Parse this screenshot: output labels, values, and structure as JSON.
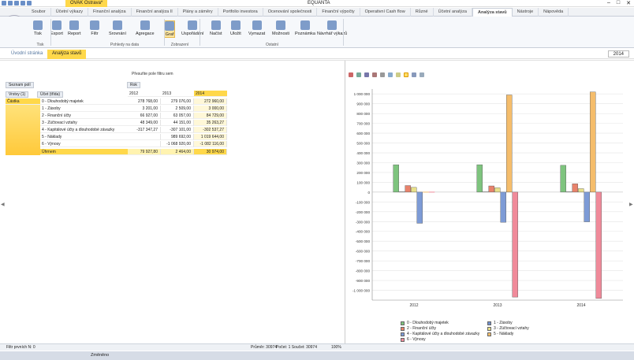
{
  "titlebar": {
    "doc": "OVAK Ostrava*",
    "app": "EQUANTA"
  },
  "menu": [
    "Soubor",
    "Účetní výkazy",
    "Finanční analýza",
    "Finanční analýza II",
    "Plány a záměry",
    "Portfolio investora",
    "Ocenování společnosti",
    "Finanční výpočty",
    "Operativní Cash flow",
    "Různé",
    "Účetní analýza",
    "Analýza stavů",
    "Nástroje",
    "Nápověda"
  ],
  "menu_active": 11,
  "ribbon": {
    "buttons": [
      "Tisk",
      "Export",
      "Report",
      "Filtr",
      "Srovnání",
      "Agregace",
      "Graf",
      "Uspořádání",
      "Načíst",
      "Uložit",
      "Vymazat",
      "Možnosti",
      "Poznámka",
      "Návrhář výkazů"
    ],
    "groups": [
      "Tisk",
      "Pohledy na data",
      "Zobrazení",
      "Ostatní"
    ]
  },
  "tabs": {
    "home": "Úvodní stránka",
    "active": "Analýza stavů"
  },
  "year_select": "2014",
  "pivot": {
    "dropzone": "Přesuňte pole filtru sem",
    "field_list": "Seznam polí",
    "col_field": "Rok",
    "row_fields": [
      "Vrstvy (1)",
      "Účet (třída)"
    ],
    "measure": "Částka",
    "years": [
      "2012",
      "2013",
      "2014"
    ],
    "rows": [
      {
        "label": "0 - Dlouhodobý majetek",
        "v": [
          "278 768,00",
          "279 076,00",
          "272 960,00"
        ]
      },
      {
        "label": "1 - Zásoby",
        "v": [
          "3 201,00",
          "2 509,00",
          "3 000,00"
        ]
      },
      {
        "label": "2 - Finanční účty",
        "v": [
          "66 927,00",
          "63 057,00",
          "84 729,00"
        ]
      },
      {
        "label": "3 - Zúčtovací vztahy",
        "v": [
          "48 349,00",
          "44 151,00",
          "35 263,27"
        ]
      },
      {
        "label": "4 - Kapitálové účty a dlouhodobé závazky",
        "v": [
          "-317 347,27",
          "-307 101,00",
          "-302 537,27"
        ]
      },
      {
        "label": "5 - Náklady",
        "v": [
          "",
          "989 692,00",
          "1 019 644,00"
        ]
      },
      {
        "label": "6 - Výnosy",
        "v": [
          "",
          "-1 068 920,00",
          "-1 082 116,00"
        ]
      }
    ],
    "total": {
      "label": "Úhrnem",
      "v": [
        "79 927,80",
        "2 464,00",
        "30 974,00"
      ]
    }
  },
  "status": {
    "filter": "Filtr prvních N: 0",
    "avg": "Průměr: 30974",
    "count": "Počet: 1  Součet: 30974",
    "zoom": "100%"
  },
  "bottom": {
    "label": "Změněno"
  },
  "colors": {
    "accent": "#ffd84a",
    "s0": "#7ec47e",
    "s1": "#6f8fce",
    "s2": "#e8826b",
    "s3": "#e8e08a",
    "s4": "#7d9bd6",
    "s5": "#f5bd6b",
    "s6": "#f08a9a"
  },
  "chart_data": {
    "type": "bar",
    "categories": [
      "2012",
      "2013",
      "2014"
    ],
    "ylim": [
      -1100000,
      1050000
    ],
    "yticks": [
      "1 000 000",
      "900 000",
      "800 000",
      "700 000",
      "600 000",
      "500 000",
      "400 000",
      "300 000",
      "200 000",
      "100 000",
      "0",
      "-100 000",
      "-200 000",
      "-300 000",
      "-400 000",
      "-500 000",
      "-600 000",
      "-700 000",
      "-800 000",
      "-900 000",
      "-1 000 000"
    ],
    "series": [
      {
        "name": "0 - Dlouhodobý majetek",
        "values": [
          278768,
          279076,
          272960
        ]
      },
      {
        "name": "1 - Zásoby",
        "values": [
          3201,
          2509,
          3000
        ]
      },
      {
        "name": "2 - Finanční účty",
        "values": [
          66927,
          63057,
          84729
        ]
      },
      {
        "name": "3 - Zúčtovací vztahy",
        "values": [
          48349,
          44151,
          35263.27
        ]
      },
      {
        "name": "4 - Kapitálové účty a dlouhodobé závazky",
        "values": [
          -317347.27,
          -307101,
          -302537.27
        ]
      },
      {
        "name": "5 - Náklady",
        "values": [
          0,
          989692,
          1019644
        ]
      },
      {
        "name": "6 - Výnosy",
        "values": [
          0,
          -1068920,
          -1082116
        ]
      }
    ],
    "legend": "bottom"
  }
}
